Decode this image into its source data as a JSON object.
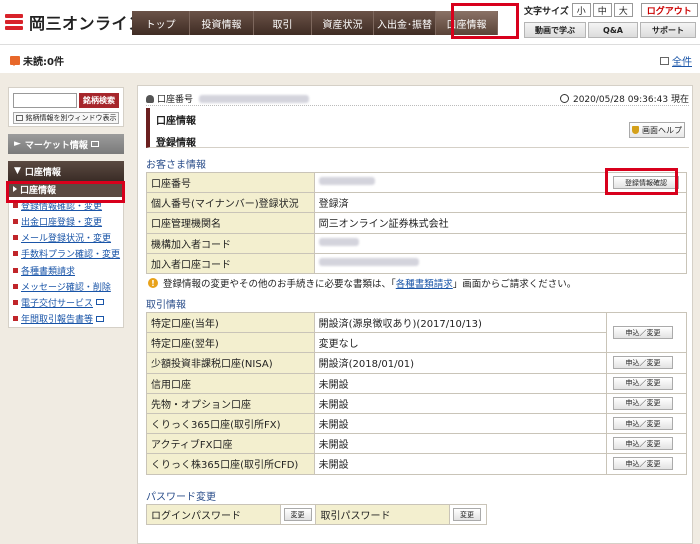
{
  "header": {
    "logo_text": "岡三オンライン",
    "nav": [
      "トップ",
      "投資情報",
      "取引",
      "資産状況",
      "入出金･振替",
      "口座情報"
    ],
    "text_size_label": "文字サイズ",
    "text_sizes": [
      "小",
      "中",
      "大"
    ],
    "logout": "ログアウト",
    "util_buttons": [
      "動画で学ぶ",
      "Q&A",
      "サポート"
    ]
  },
  "infobar": {
    "unread": "未読:0件",
    "all": "全件"
  },
  "sidebar": {
    "search_button": "銘柄検索",
    "search_newwin": "銘柄情報を別ウィンドウ表示",
    "market_info": "マーケット情報",
    "account_info": "口座情報",
    "items": [
      "口座情報",
      "登録情報確認・変更",
      "出金口座登録・変更",
      "メール登録状況・変更",
      "手数料プラン確認・変更",
      "各種書類請求",
      "メッセージ確認・削除",
      "電子交付サービス",
      "年間取引報告書等"
    ]
  },
  "main": {
    "account_label": "口座番号",
    "datetime": "2020/05/28 09:36:43 現在",
    "title1": "口座情報",
    "title2": "登録情報",
    "help_button": "画面ヘルプ",
    "customer_section": "お客さま情報",
    "customer_rows": [
      {
        "label": "口座番号",
        "value": ""
      },
      {
        "label": "個人番号(マイナンバー)登録状況",
        "value": "登録済"
      },
      {
        "label": "口座管理機関名",
        "value": "岡三オンライン証券株式会社"
      },
      {
        "label": "機構加入者コード",
        "value": ""
      },
      {
        "label": "加入者口座コード",
        "value": ""
      }
    ],
    "confirm_button": "登録情報確認",
    "notice_pre": "登録情報の変更やその他のお手続きに必要な書類は、「",
    "notice_link": "各種書類請求",
    "notice_post": "」画面からご請求ください。",
    "trade_section": "取引情報",
    "trade_rows": [
      {
        "label": "特定口座(当年)",
        "value": "開設済(源泉徴収あり)(2017/10/13)",
        "button": "申込／変更"
      },
      {
        "label": "特定口座(翌年)",
        "value": "変更なし",
        "button": ""
      },
      {
        "label": "少額投資非課税口座(NISA)",
        "value": "開設済(2018/01/01)",
        "button": "申込／変更"
      },
      {
        "label": "信用口座",
        "value": "未開設",
        "button": "申込／変更"
      },
      {
        "label": "先物・オプション口座",
        "value": "未開設",
        "button": "申込／変更"
      },
      {
        "label": "くりっく365口座(取引所FX)",
        "value": "未開設",
        "button": "申込／変更"
      },
      {
        "label": "アクティブFX口座",
        "value": "未開設",
        "button": "申込／変更"
      },
      {
        "label": "くりっく株365口座(取引所CFD)",
        "value": "未開設",
        "button": "申込／変更"
      }
    ],
    "password_section": "パスワード変更",
    "login_password": "ログインパスワード",
    "trade_password": "取引パスワード",
    "change_button": "変更"
  }
}
